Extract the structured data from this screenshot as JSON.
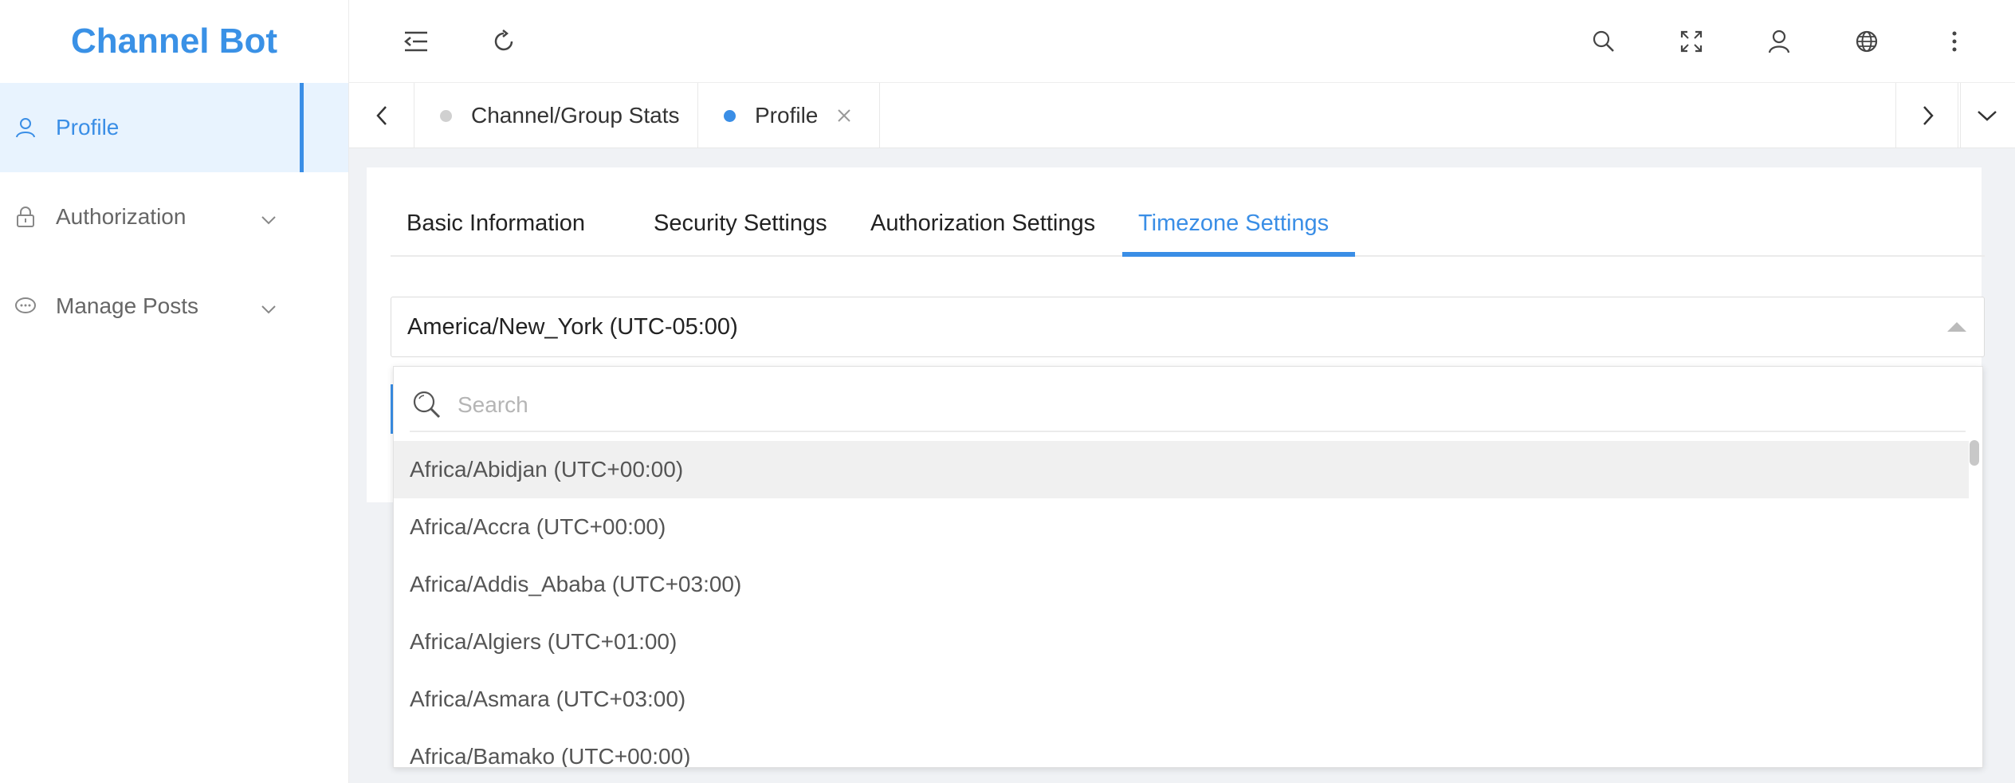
{
  "brand": "Channel Bot",
  "sidebar": {
    "items": [
      {
        "label": "Profile",
        "icon": "user-icon",
        "active": true
      },
      {
        "label": "Authorization",
        "icon": "lock-icon"
      },
      {
        "label": "Manage Posts",
        "icon": "chat-icon"
      }
    ]
  },
  "topbar": {
    "icons": [
      "menu-fold-icon",
      "refresh-icon",
      "search-icon",
      "fullscreen-icon",
      "user-icon",
      "globe-icon",
      "more-icon"
    ]
  },
  "tabs": {
    "items": [
      {
        "label": "Channel/Group Stats",
        "dot_color": "#d0d0d0"
      },
      {
        "label": "Profile",
        "dot_color": "#3a8ee6",
        "closable": true
      }
    ]
  },
  "settings_tabs": {
    "items": [
      "Basic Information",
      "Security Settings",
      "Authorization Settings",
      "Timezone Settings"
    ],
    "active": "Timezone Settings"
  },
  "timezone_select": {
    "value": "America/New_York (UTC-05:00)",
    "search_placeholder": "Search",
    "options": [
      "Africa/Abidjan (UTC+00:00)",
      "Africa/Accra (UTC+00:00)",
      "Africa/Addis_Ababa (UTC+03:00)",
      "Africa/Algiers (UTC+01:00)",
      "Africa/Asmara (UTC+03:00)",
      "Africa/Bamako (UTC+00:00)"
    ]
  },
  "colors": {
    "accent": "#3a8ee6",
    "sidebar_active_bg": "#e8f3fe"
  }
}
